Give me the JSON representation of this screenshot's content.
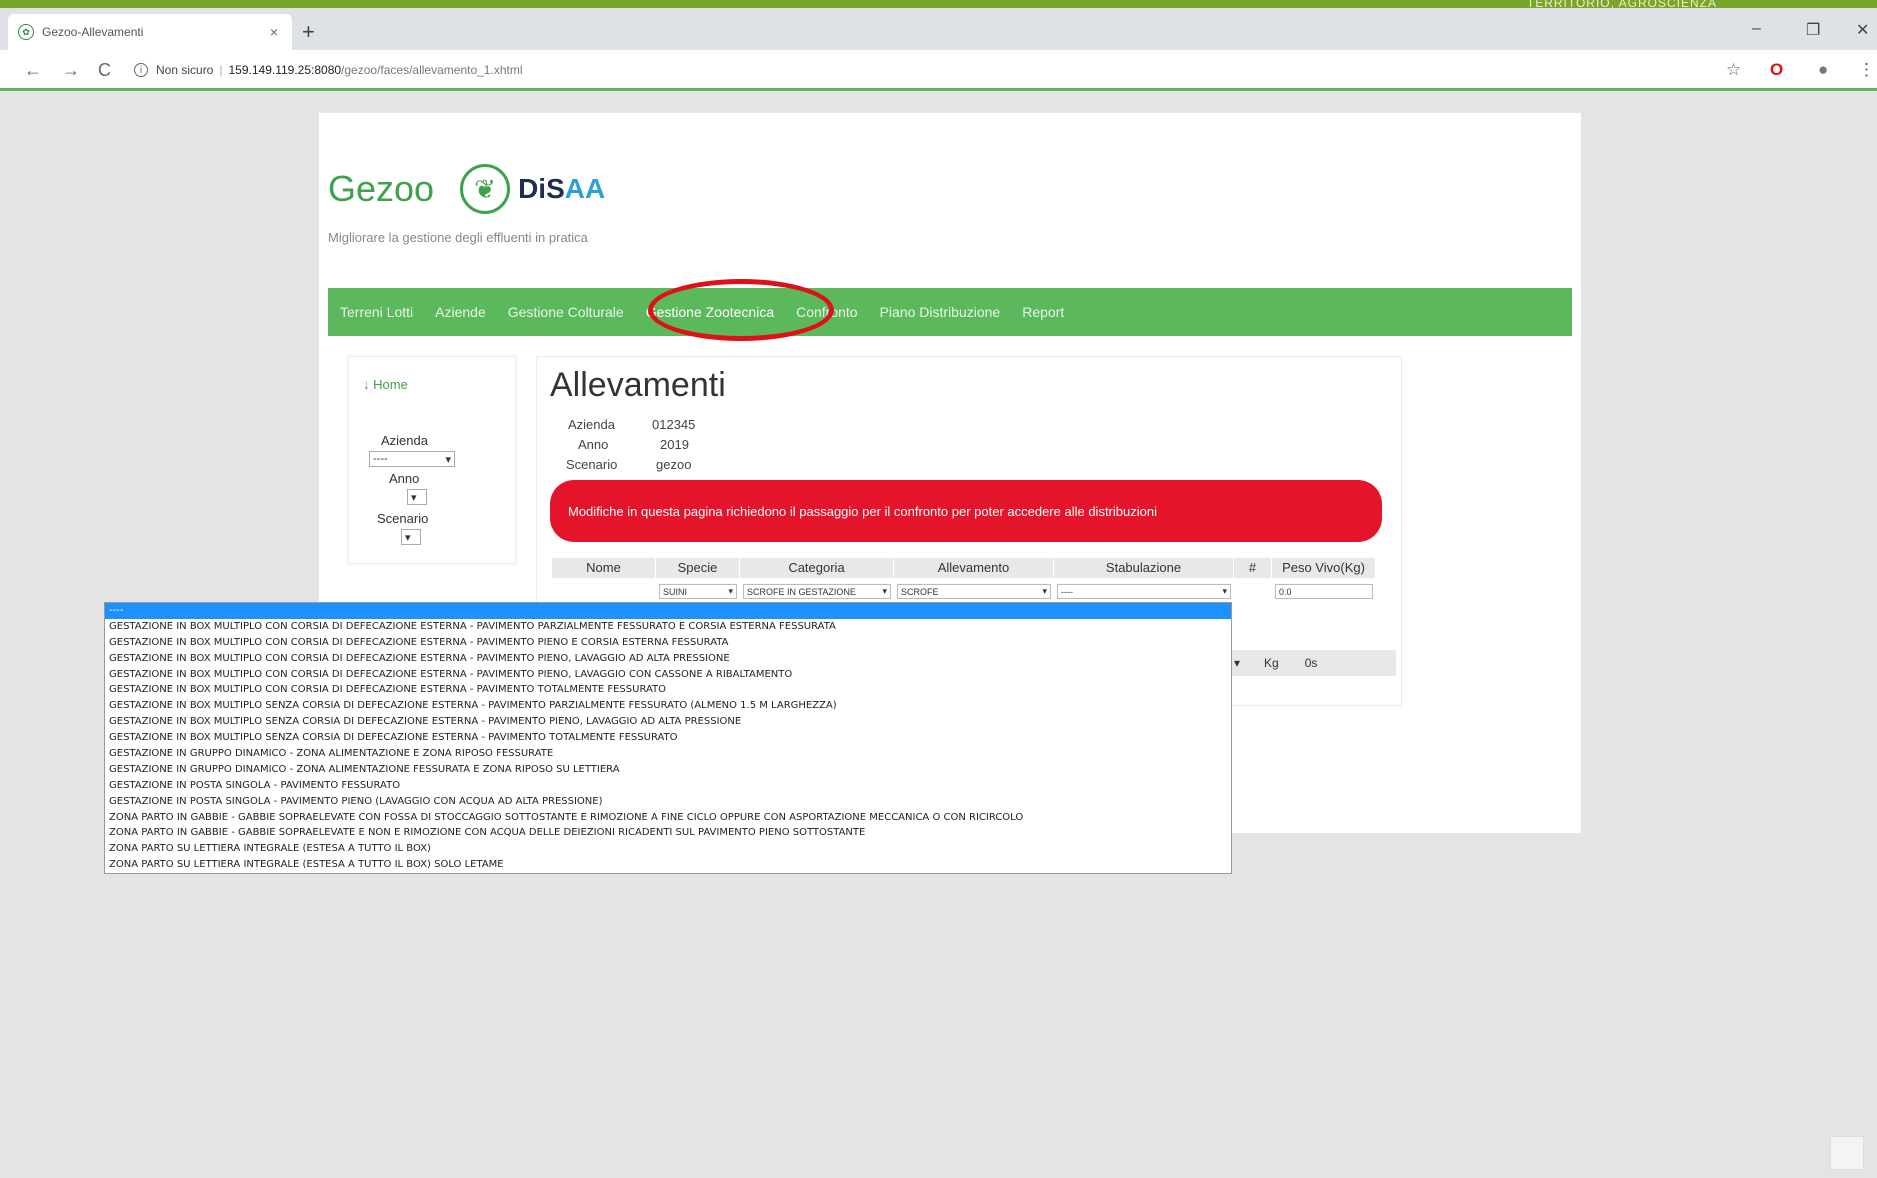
{
  "browser": {
    "top_strip_text": "TERRITORIO, AGROSCIENZA",
    "tab_title": "Gezoo-Allevamenti",
    "tab_close": "×",
    "new_tab": "+",
    "security": "Non sicuro",
    "url_host": "159.149.119.25:8080",
    "url_path": "/gezoo/faces/allevamento_1.xhtml",
    "back": "←",
    "forward": "→",
    "reload": "C",
    "minimize": "–",
    "maximize": "❐",
    "close": "✕",
    "star": "☆",
    "menu": "⋮"
  },
  "header": {
    "app_title": "Gezoo",
    "logo_text_main": "DiS",
    "logo_text_accent": "AA",
    "subtitle": "Migliorare la gestione degli effluenti in pratica"
  },
  "navbar": {
    "items": [
      "Terreni Lotti",
      "Aziende",
      "Gestione Colturale",
      "Gestione Zootecnica",
      "Confronto",
      "Piano Distribuzione",
      "Report"
    ]
  },
  "sidebar": {
    "home": "Home",
    "azienda_label": "Azienda",
    "azienda_value": "----",
    "anno_label": "Anno",
    "scenario_label": "Scenario"
  },
  "main": {
    "title": "Allevamenti",
    "azienda_label": "Azienda",
    "azienda_value": "012345",
    "anno_label": "Anno",
    "anno_value": "2019",
    "scenario_label": "Scenario",
    "scenario_value": "gezoo",
    "alert": "Modifiche in questa pagina richiedono il passaggio per il confronto per poter accedere alle distribuzioni"
  },
  "table": {
    "headers": [
      "Nome",
      "Specie",
      "Categoria",
      "Allevamento",
      "Stabulazione",
      "#",
      "Peso Vivo(Kg)"
    ],
    "row": {
      "specie": "SUINI",
      "categoria": "SCROFE IN GESTAZIONE",
      "allevamento": "SCROFE",
      "stabulazione": "----",
      "peso": "0.0"
    },
    "summary": {
      "kg": "Kg",
      "value": "0s"
    }
  },
  "dropdown": {
    "selected": "----",
    "options": [
      "GESTAZIONE IN BOX MULTIPLO CON CORSIA DI DEFECAZIONE ESTERNA - PAVIMENTO PARZIALMENTE FESSURATO E CORSIA ESTERNA FESSURATA",
      "GESTAZIONE IN BOX MULTIPLO CON CORSIA DI DEFECAZIONE ESTERNA - PAVIMENTO PIENO E CORSIA ESTERNA FESSURATA",
      "GESTAZIONE IN BOX MULTIPLO CON CORSIA DI DEFECAZIONE ESTERNA - PAVIMENTO PIENO, LAVAGGIO AD ALTA PRESSIONE",
      "GESTAZIONE IN BOX MULTIPLO CON CORSIA DI DEFECAZIONE ESTERNA - PAVIMENTO PIENO, LAVAGGIO CON CASSONE A RIBALTAMENTO",
      "GESTAZIONE IN BOX MULTIPLO CON CORSIA DI DEFECAZIONE ESTERNA - PAVIMENTO TOTALMENTE FESSURATO",
      "GESTAZIONE IN BOX MULTIPLO SENZA CORSIA DI DEFECAZIONE ESTERNA - PAVIMENTO PARZIALMENTE FESSURATO (ALMENO 1.5 M LARGHEZZA)",
      "GESTAZIONE IN BOX MULTIPLO SENZA CORSIA DI DEFECAZIONE ESTERNA - PAVIMENTO PIENO, LAVAGGIO AD ALTA PRESSIONE",
      "GESTAZIONE IN BOX MULTIPLO SENZA CORSIA DI DEFECAZIONE ESTERNA - PAVIMENTO TOTALMENTE FESSURATO",
      "GESTAZIONE IN GRUPPO DINAMICO - ZONA ALIMENTAZIONE E ZONA RIPOSO FESSURATE",
      "GESTAZIONE IN GRUPPO DINAMICO - ZONA ALIMENTAZIONE FESSURATA E ZONA RIPOSO SU LETTIERA",
      "GESTAZIONE IN POSTA SINGOLA - PAVIMENTO FESSURATO",
      "GESTAZIONE IN POSTA SINGOLA - PAVIMENTO PIENO (LAVAGGIO CON ACQUA AD ALTA PRESSIONE)",
      "ZONA PARTO IN GABBIE - GABBIE SOPRAELEVATE CON FOSSA DI STOCCAGGIO SOTTOSTANTE E RIMOZIONE A FINE CICLO OPPURE CON ASPORTAZIONE MECCANICA O CON RICIRCOLO",
      "ZONA PARTO IN GABBIE - GABBIE SOPRAELEVATE E NON E RIMOZIONE CON ACQUA DELLE DEIEZIONI RICADENTI SUL PAVIMENTO PIENO SOTTOSTANTE",
      "ZONA PARTO SU LETTIERA INTEGRALE (ESTESA A TUTTO IL BOX)",
      "ZONA PARTO SU LETTIERA INTEGRALE (ESTESA A TUTTO IL BOX) SOLO LETAME"
    ]
  },
  "colors": {
    "brand_green": "#5cb85c",
    "alert_red": "#e4142a",
    "highlight_red": "#e0101a",
    "dropdown_selected": "#1e90ff"
  }
}
